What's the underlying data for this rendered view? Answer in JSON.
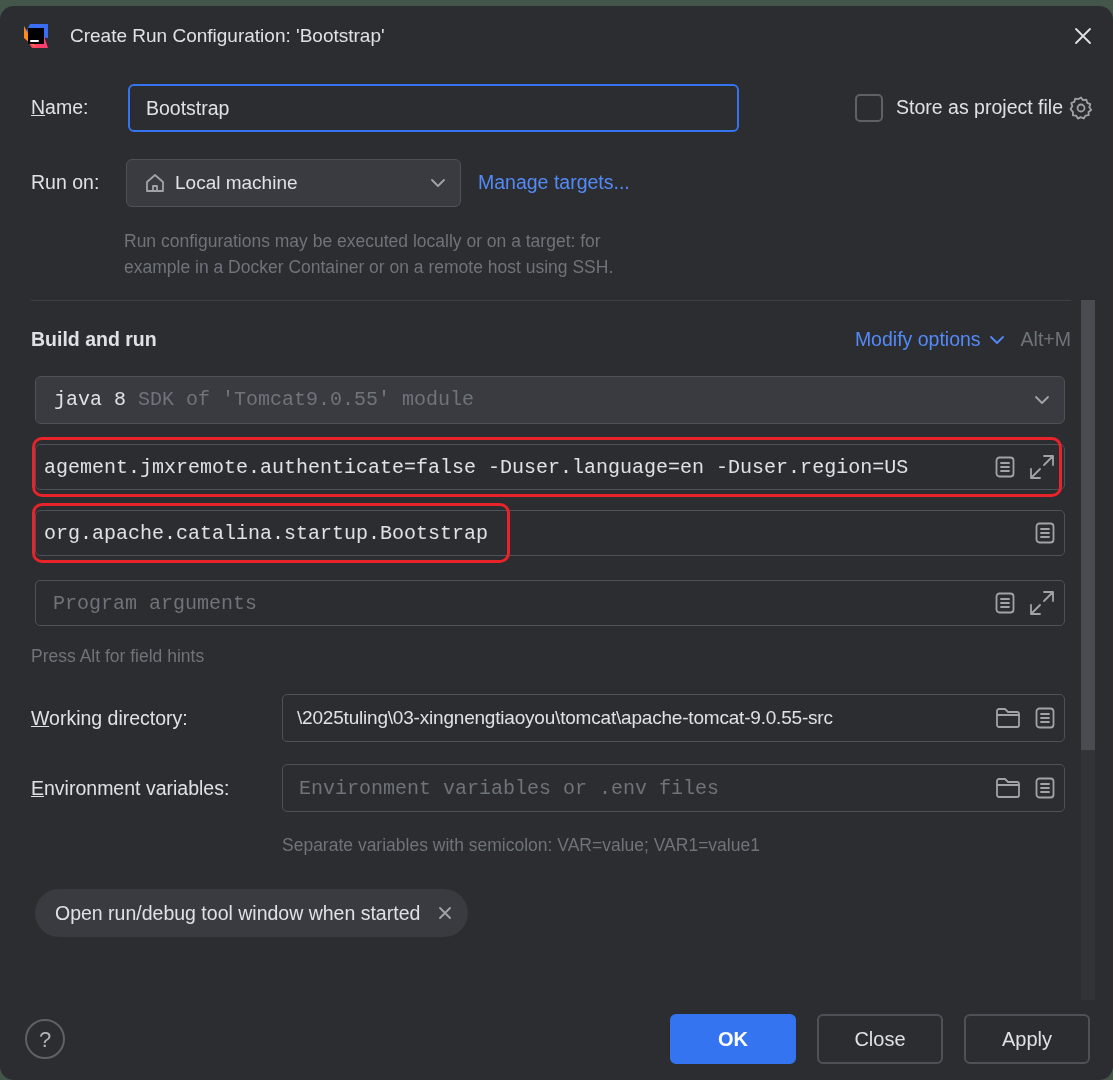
{
  "window": {
    "title": "Create Run Configuration: 'Bootstrap'"
  },
  "name_field": {
    "label": "Name:",
    "mnemonic": true,
    "value": "Bootstrap",
    "focused": true
  },
  "store_as_project_file": {
    "label": "Store as project file",
    "checked": false
  },
  "run_on": {
    "label": "Run on:",
    "value": "Local machine",
    "link": "Manage targets..."
  },
  "run_on_hint": "Run configurations may be executed locally or on a target: for example in a Docker Container or on a remote host using SSH.",
  "section": {
    "title": "Build and run",
    "modify_options": "Modify options",
    "shortcut": "Alt+M"
  },
  "sdk": {
    "value": "java 8",
    "detail": "SDK of 'Tomcat9.0.55' module"
  },
  "fields": [
    {
      "value": "agement.jmxremote.authenticate=false -Duser.language=en -Duser.region=US",
      "highlighted": true,
      "expandable": true
    },
    {
      "value": "org.apache.catalina.startup.Bootstrap",
      "highlighted": true,
      "expandable": false
    },
    {
      "placeholder": "Program arguments",
      "highlighted": false,
      "expandable": true
    }
  ],
  "field_hint": "Press Alt for field hints",
  "form_rows": [
    {
      "kind": "path",
      "label": "Working directory:",
      "mnemonic": true,
      "value": "\\2025tuling\\03-xingnengtiaoyou\\tomcat\\apache-tomcat-9.0.55-src"
    },
    {
      "kind": "env",
      "label": "Environment variables:",
      "mnemonic": true,
      "placeholder": "Environment variables or .env files"
    }
  ],
  "env_hint": "Separate variables with semicolon: VAR=value; VAR1=value1",
  "chips": [
    {
      "label": "Open run/debug tool window when started"
    }
  ],
  "help": "?",
  "buttons": [
    {
      "label": "OK",
      "primary": true
    },
    {
      "label": "Close",
      "primary": false
    },
    {
      "label": "Apply",
      "primary": false
    }
  ]
}
